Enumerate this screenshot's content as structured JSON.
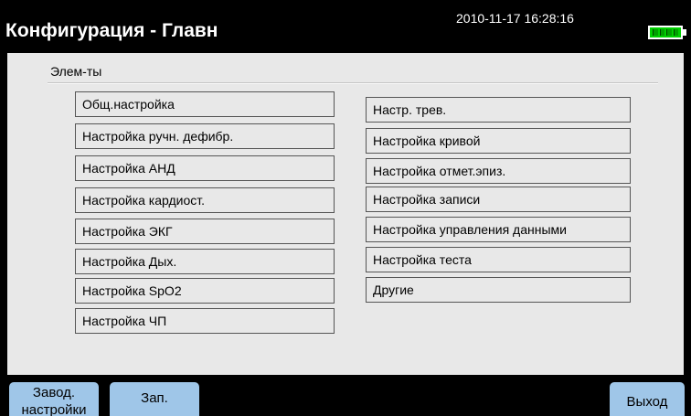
{
  "header": {
    "title": "Конфигурация - Главн",
    "datetime": "2010-11-17 16:28:16",
    "battery_icon": "battery-full-icon",
    "battery_color": "#00d000"
  },
  "section": {
    "label": "Элем-ты"
  },
  "menu": {
    "left": [
      "Общ.настройка",
      "Настройка ручн. дефибр.",
      "Настройка АНД",
      "Настройка кардиост.",
      "Настройка ЭКГ",
      "Настройка Дых.",
      "Настройка SpO2",
      "Настройка ЧП"
    ],
    "right": [
      "Настр. трев.",
      "Настройка кривой",
      "Настройка отмет.эпиз.",
      "Настройка записи",
      "Настройка управления данными",
      "Настройка теста",
      "Другие"
    ]
  },
  "softkeys": {
    "factory_line1": "Завод.",
    "factory_line2": "настройки",
    "save": "Зап.",
    "exit": "Выход"
  },
  "colors": {
    "background": "#000000",
    "panel": "#e8e8e8",
    "softkey": "#9fc6e8"
  }
}
